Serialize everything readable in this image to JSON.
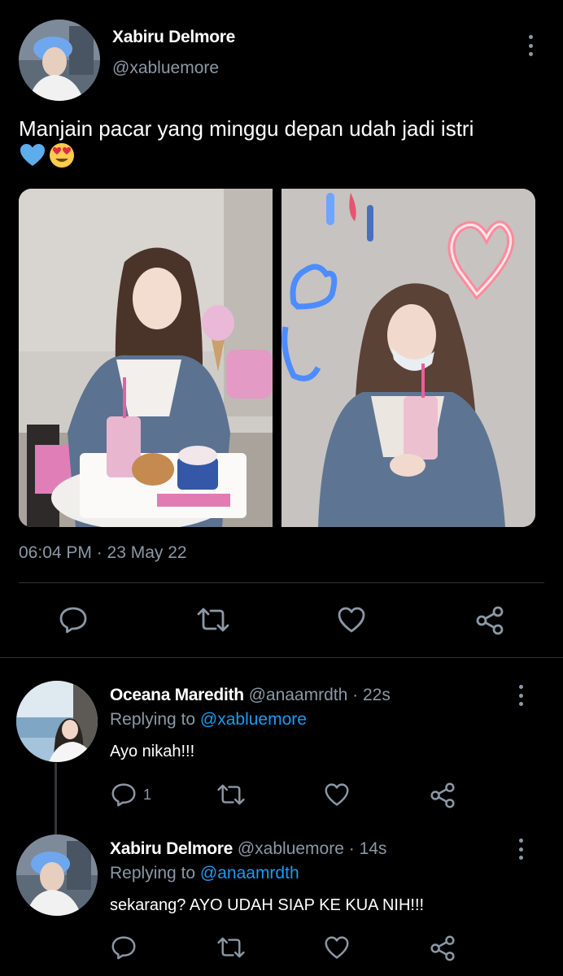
{
  "tweet": {
    "author_name": "Xabiru Delmore",
    "author_handle": "@xabluemore",
    "text": "Manjain pacar yang minggu depan udah jadi istri",
    "emojis": [
      "blue-heart",
      "heart-eyes-face"
    ],
    "timestamp": "06:04 PM · 23 May 22"
  },
  "replies": [
    {
      "name": "Oceana Maredith",
      "handle": "@anaamrdth",
      "age": "· 22s",
      "replying_prefix": "Replying to ",
      "replying_to": "@xabluemore",
      "text": "Ayo nikah!!!",
      "reply_count": "1"
    },
    {
      "name": "Xabiru Delmore",
      "handle": "@xabluemore",
      "age": "· 14s",
      "replying_prefix": "Replying to ",
      "replying_to": "@anaamrdth",
      "text": "sekarang? AYO UDAH SIAP KE KUA NIH!!!",
      "reply_count": ""
    }
  ],
  "colors": {
    "background": "#000000",
    "secondary_text": "#8b98a5",
    "link": "#1d9bf0",
    "divider": "#2f3336"
  },
  "icons": [
    "more-icon",
    "reply-icon",
    "retweet-icon",
    "like-icon",
    "share-icon"
  ]
}
